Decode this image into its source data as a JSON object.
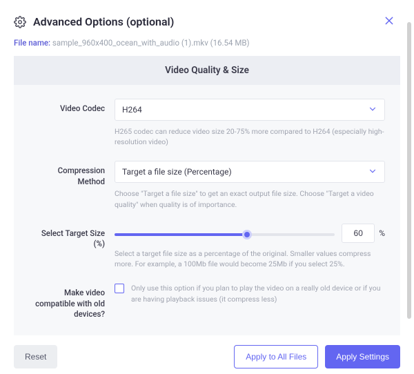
{
  "header": {
    "title": "Advanced Options (optional)"
  },
  "file": {
    "label": "File name:",
    "name": "sample_960x400_ocean_with_audio (1).mkv",
    "size": "(16.54 MB)"
  },
  "panel": {
    "title": "Video Quality & Size",
    "codec": {
      "label": "Video Codec",
      "value": "H264",
      "hint": "H265 codec can reduce video size 20-75% more compared to H264 (especially high-resolution video)"
    },
    "compression": {
      "label": "Compression Method",
      "value": "Target a file size (Percentage)",
      "hint": "Choose \"Target a file size\" to get an exact output file size. Choose \"Target a video quality\" when quality is of importance."
    },
    "target_size": {
      "label": "Select Target Size (%)",
      "value": "60",
      "unit": "%",
      "hint": "Select a target file size as a percentage of the original. Smaller values compress more. For example, a 100Mb file would become 25Mb if you select 25%."
    },
    "compat": {
      "label": "Make video compatible with old devices?",
      "checked": false,
      "hint": "Only use this option if you plan to play the video on a really old device or if you are having playback issues (it compress less)"
    }
  },
  "footer": {
    "reset": "Reset",
    "apply_all": "Apply to All Files",
    "apply": "Apply Settings"
  },
  "colors": {
    "accent": "#6366f1"
  }
}
